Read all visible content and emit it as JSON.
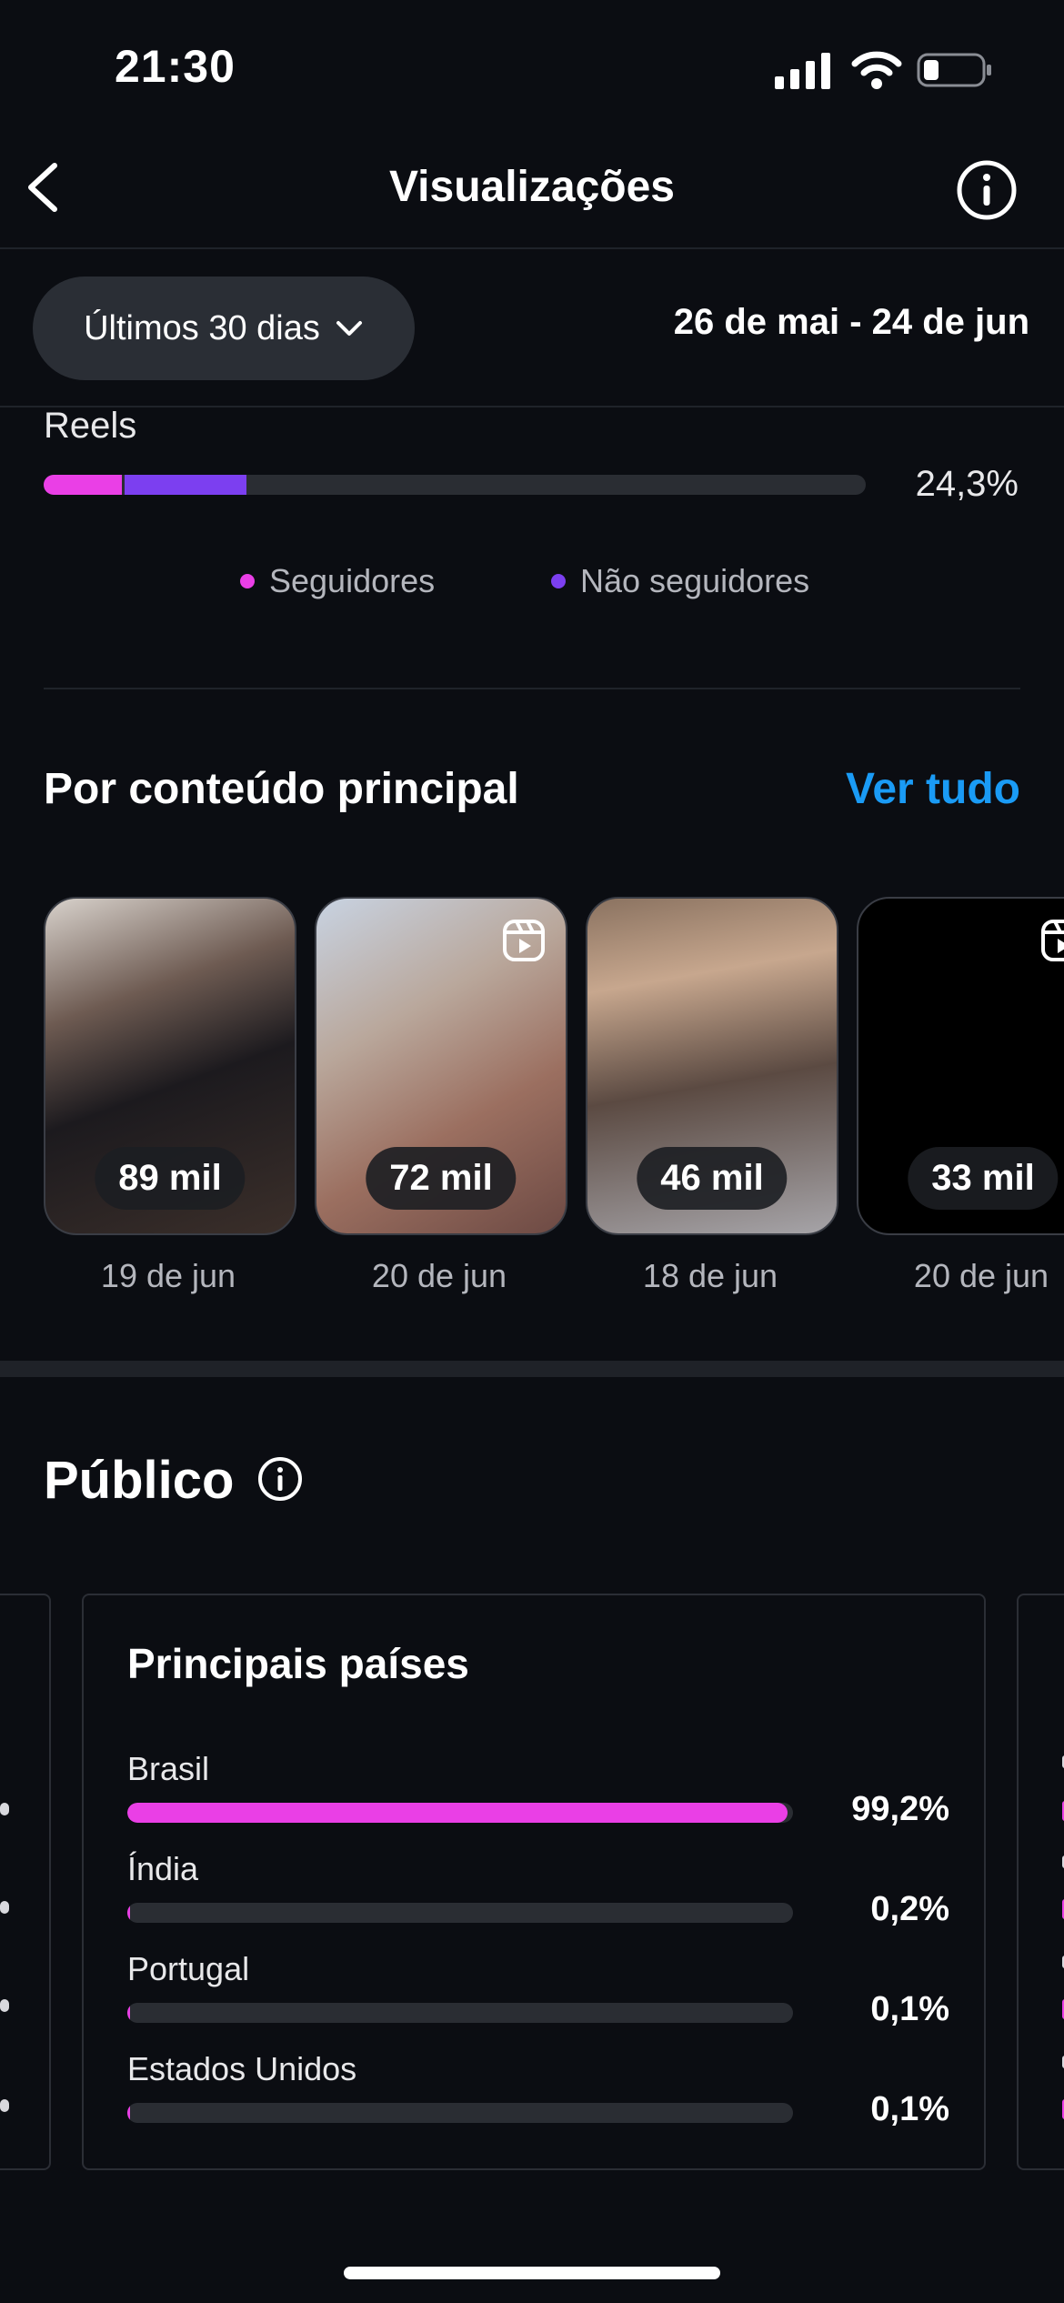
{
  "status": {
    "time": "21:30"
  },
  "nav": {
    "title": "Visualizações"
  },
  "period": {
    "label": "Últimos 30 dias",
    "range": "26 de mai - 24 de jun"
  },
  "reels": {
    "label": "Reels",
    "percent": "24,3%",
    "followers_fraction": 0.095,
    "non_followers_fraction": 0.148
  },
  "legend": {
    "followers": "Seguidores",
    "non_followers": "Não seguidores"
  },
  "colors": {
    "followers": "#ea3fe6",
    "non_followers": "#7c3ff0",
    "link": "#1a9bf5"
  },
  "content": {
    "title": "Por conteúdo principal",
    "see_all": "Ver tudo",
    "items": [
      {
        "views": "89 mil",
        "date": "19 de jun"
      },
      {
        "views": "72 mil",
        "date": "20 de jun"
      },
      {
        "views": "46 mil",
        "date": "18 de jun"
      },
      {
        "views": "33 mil",
        "date": "20 de jun"
      }
    ]
  },
  "audience": {
    "title": "Público",
    "countries_title": "Principais países",
    "countries": [
      {
        "name": "Brasil",
        "percent": "99,2%",
        "value": 0.992
      },
      {
        "name": "Índia",
        "percent": "0,2%",
        "value": 0.002
      },
      {
        "name": "Portugal",
        "percent": "0,1%",
        "value": 0.001
      },
      {
        "name": "Estados Unidos",
        "percent": "0,1%",
        "value": 0.001
      }
    ]
  }
}
